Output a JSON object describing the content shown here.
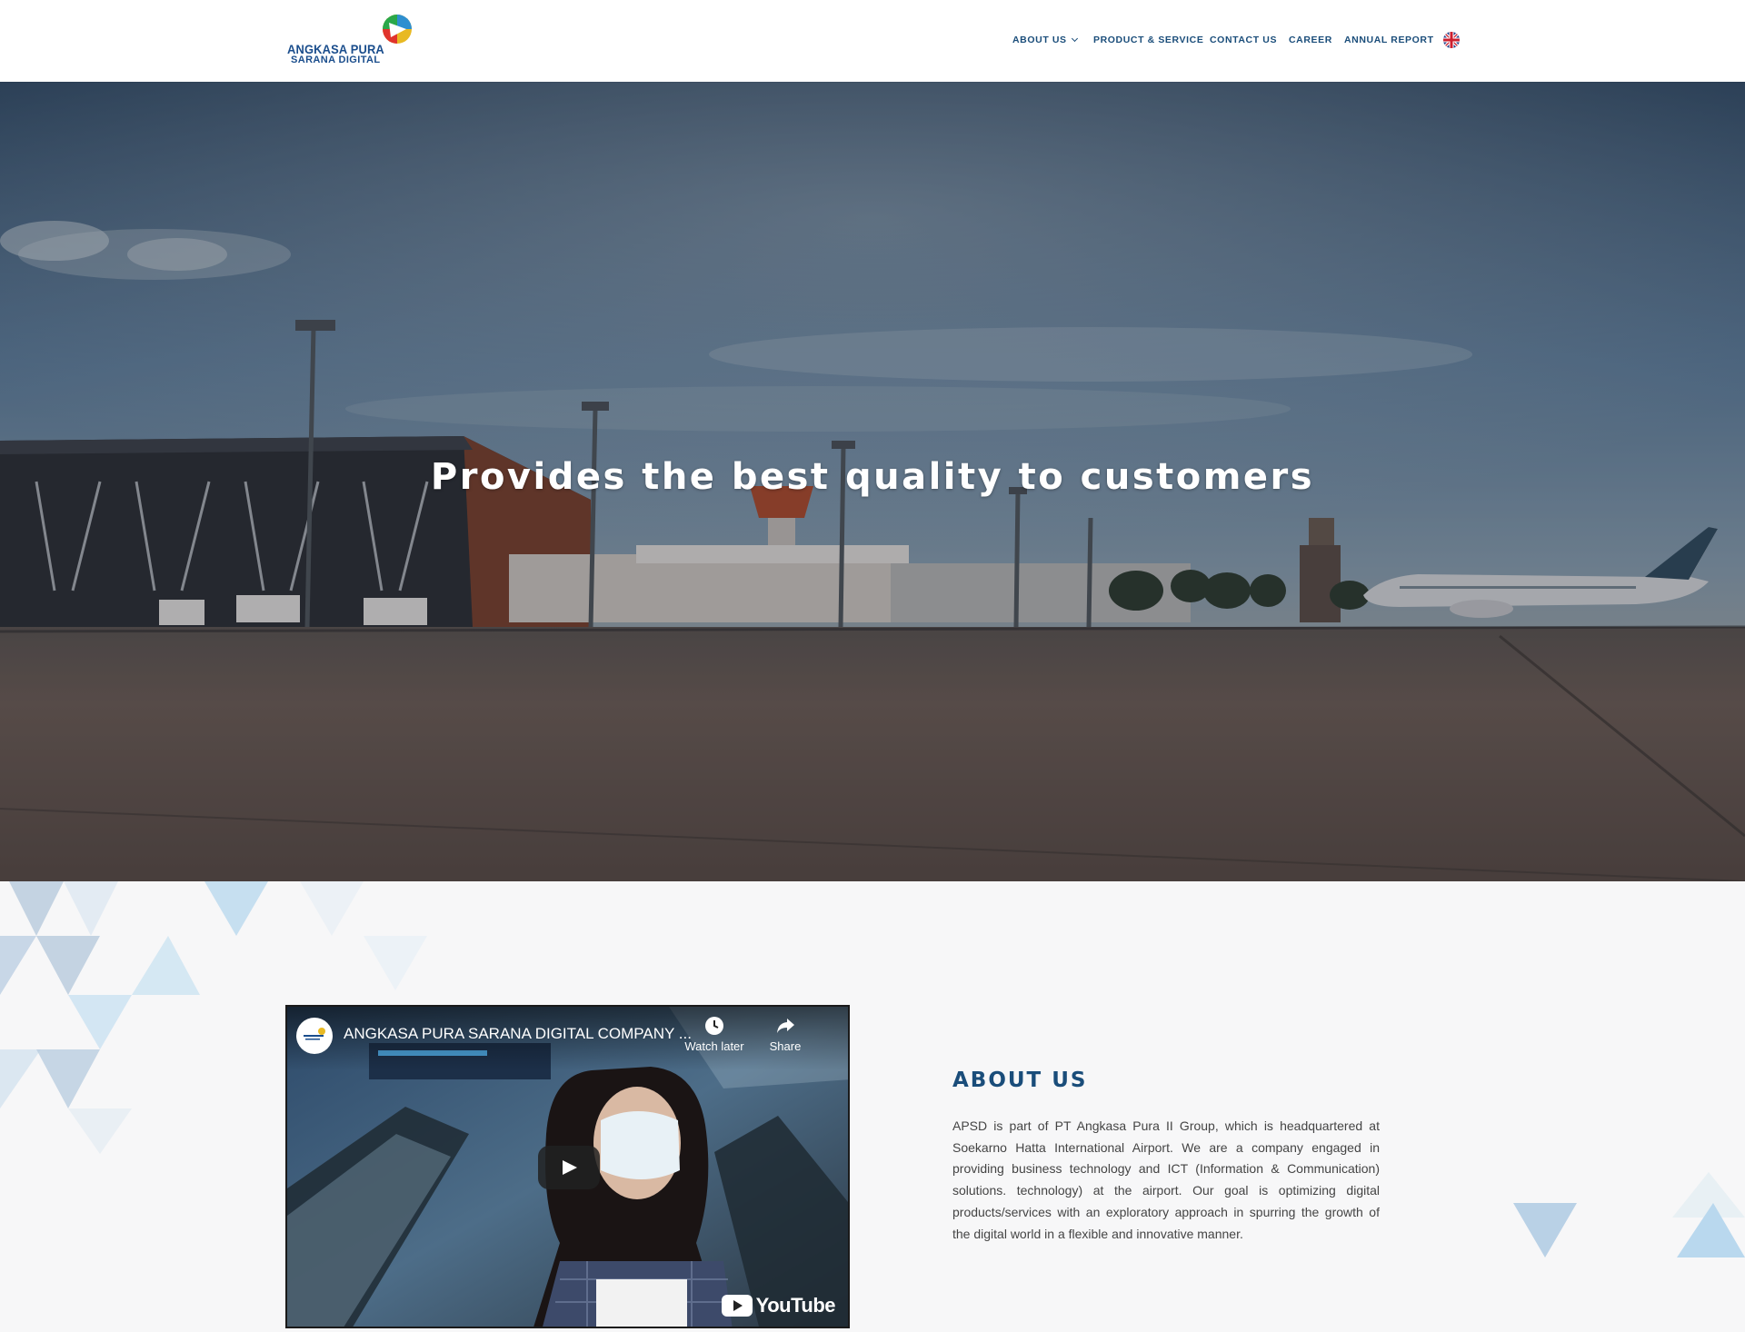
{
  "brand": {
    "logo_line1": "ANGKASA PURA",
    "logo_line2": "SARANA DIGITAL",
    "primary_color": "#1a4d7a"
  },
  "nav": {
    "about": "ABOUT US",
    "product": "PRODUCT & SERVICE",
    "contact": "CONTACT US",
    "career": "CAREER",
    "annual": "ANNUAL REPORT",
    "language_icon": "uk-flag-icon"
  },
  "hero": {
    "title": "Provides the best quality to customers"
  },
  "video": {
    "title": "ANGKASA PURA SARANA DIGITAL COMPANY ...",
    "watch_later": "Watch later",
    "share": "Share",
    "platform": "YouTube"
  },
  "about": {
    "title": "ABOUT US",
    "body": "APSD is part of PT Angkasa Pura II Group, which is headquartered at Soekarno Hatta International Airport. We are a company engaged in providing business technology and ICT (Information & Communication) solutions. technology) at the airport. Our goal is optimizing digital products/services with an exploratory approach in spurring the growth of the digital world in a flexible and innovative manner."
  }
}
